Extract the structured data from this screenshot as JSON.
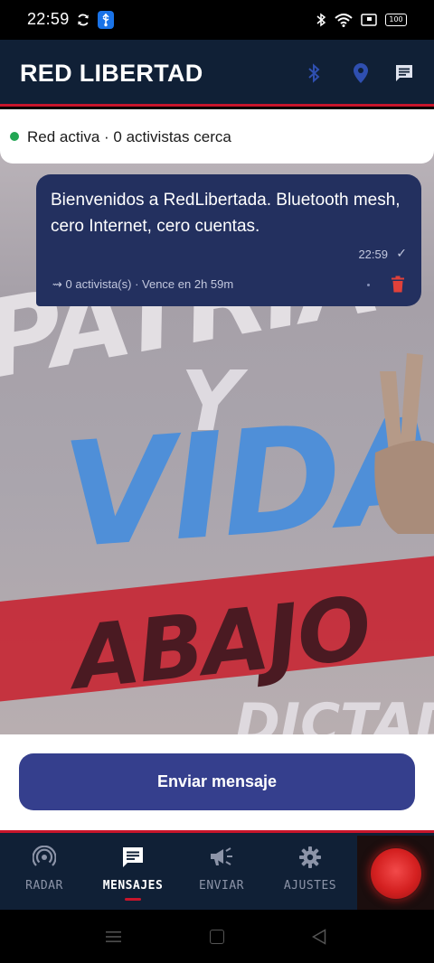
{
  "status_bar": {
    "time": "22:59",
    "battery": "100"
  },
  "app_bar": {
    "title": "RED LIBERTAD",
    "actions": [
      "bluetooth-icon",
      "location-pin-icon",
      "chat-icon"
    ]
  },
  "network_status": {
    "text": "Red activa · 0 activistas cerca",
    "indicator_color": "#22a653"
  },
  "messages": [
    {
      "text": "Bienvenidos a RedLibertada. Bluetooth mesh, cero Internet, cero cuentas.",
      "time": "22:59",
      "meta": "⇝ 0 activista(s) · Vence en 2h 59m"
    }
  ],
  "background_words": [
    "PATRIA",
    "Y",
    "VIDA",
    "ABAJO",
    "DICTADURA"
  ],
  "composer": {
    "send_label": "Enviar mensaje"
  },
  "bottom_nav": {
    "items": [
      {
        "label": "RADAR",
        "icon": "radar-icon",
        "active": false
      },
      {
        "label": "MENSAJES",
        "icon": "message-icon",
        "active": true
      },
      {
        "label": "ENVIAR",
        "icon": "megaphone-icon",
        "active": false
      },
      {
        "label": "AJUSTES",
        "icon": "gear-icon",
        "active": false
      }
    ],
    "panic_icon": "panic-button"
  },
  "colors": {
    "header": "#102036",
    "accent_red": "#c8152b",
    "bubble": "#23305f",
    "button": "#353f8d",
    "active_green": "#22a653"
  }
}
